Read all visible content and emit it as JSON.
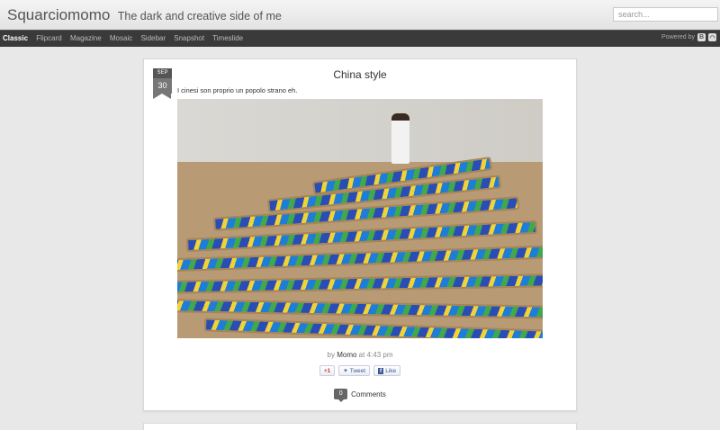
{
  "header": {
    "blog_title": "Squarciomomo",
    "blog_description": "The dark and creative side of me",
    "search_placeholder": "search..."
  },
  "nav": {
    "views": [
      "Classic",
      "Flipcard",
      "Magazine",
      "Mosaic",
      "Sidebar",
      "Snapshot",
      "Timeslide"
    ],
    "active_view": "Classic",
    "powered_by": "Powered by",
    "icons": [
      "blogger-icon",
      "rss-icon"
    ]
  },
  "post": {
    "date_month": "SEP",
    "date_day": "30",
    "title": "China style",
    "snippet": "I cinesi son proprio un popolo strano eh.",
    "byline_prefix": "by",
    "author": "Momo",
    "byline_at": "at",
    "time": "4:43 pm",
    "share_buttons": [
      "+1",
      "Tweet",
      "Like"
    ],
    "comment_count": "0",
    "comments_label": "Comments"
  },
  "colors": {
    "navbar": "#3a3a3a",
    "background": "#e8e8e8",
    "card": "#ffffff"
  }
}
